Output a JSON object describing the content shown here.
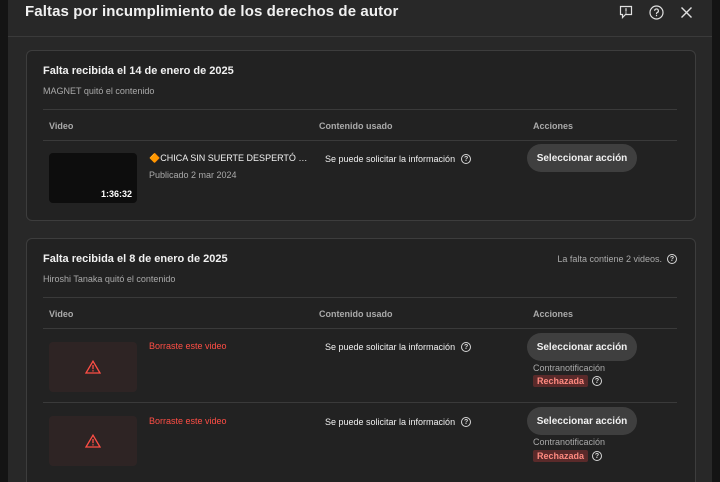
{
  "dialog": {
    "title": "Faltas por incumplimiento de los derechos de autor",
    "icons": [
      "feedback-icon",
      "help-icon",
      "close-icon"
    ]
  },
  "columns": {
    "video": "Video",
    "content_used": "Contenido usado",
    "actions": "Acciones"
  },
  "strikes": [
    {
      "title": "Falta recibida el 14 de enero de 2025",
      "subtitle": "MAGNET quitó el contenido",
      "videos": [
        {
          "title": "🔶CHICA SIN SUERTE DESPERTÓ …",
          "date": "Publicado 2 mar 2024",
          "duration": "1:36:32",
          "content_used": "Se puede solicitar la información",
          "action": "Seleccionar acción"
        }
      ]
    },
    {
      "title": "Falta recibida el 8 de enero de 2025",
      "subtitle": "Hiroshi Tanaka quitó el contenido",
      "note": "La falta contiene 2 videos.",
      "videos": [
        {
          "deleted_label": "Borraste este video",
          "content_used": "Se puede solicitar la información",
          "action": "Seleccionar acción",
          "counter_label": "Contranotificación",
          "status": "Rechazada"
        },
        {
          "deleted_label": "Borraste este video",
          "content_used": "Se puede solicitar la información",
          "action": "Seleccionar acción",
          "counter_label": "Contranotificación",
          "status": "Rechazada"
        }
      ]
    }
  ],
  "colors": {
    "background": "#282828",
    "card": "#222222",
    "accent_red": "#ff4e45",
    "badge_bg": "#5a2a2a"
  }
}
